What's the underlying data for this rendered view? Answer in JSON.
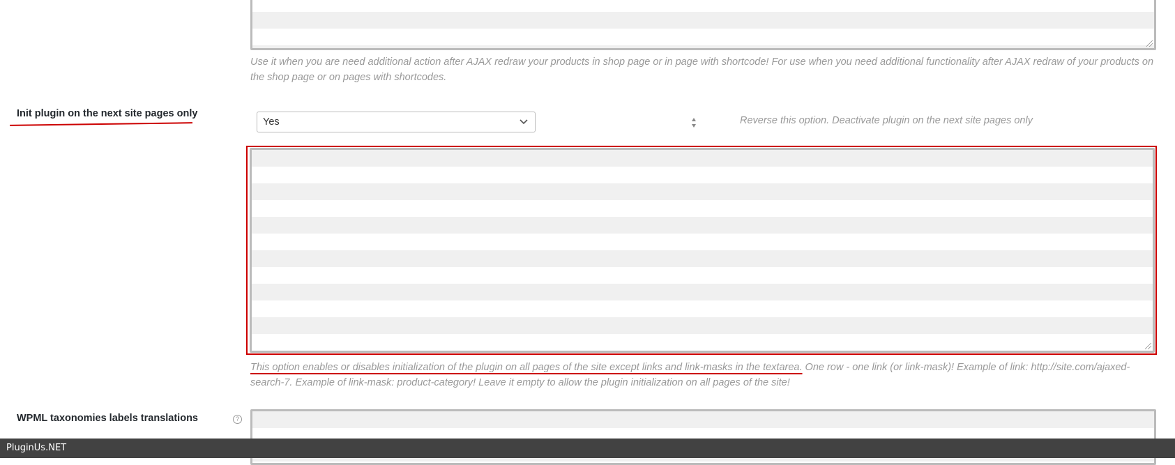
{
  "ajax_redraw": {
    "description": "Use it when you are need additional action after AJAX redraw your products in shop page or in page with shortcode! For use when you need additional functionality after AJAX redraw of your products on the shop page or on pages with shortcodes."
  },
  "init_plugin": {
    "label": "Init plugin on the next site pages only",
    "select_value": "Yes",
    "reverse_text": "Reverse this option. Deactivate plugin on the next site pages only",
    "textarea_value": "",
    "description_underlined": "This option enables or disables initialization of the plugin on all pages of the site except links and link-masks in the textarea.",
    "description_rest": " One row - one link (or link-mask)! Example of link: http://site.com/ajaxed-search-7. Example of link-mask: product-category! Leave it empty to allow the plugin initialization on all pages of the site!"
  },
  "wpml": {
    "label": "WPML taxonomies labels translations",
    "help_icon": "question-circle-icon"
  },
  "footer": {
    "brand": "PluginUs.NET"
  },
  "colors": {
    "highlight": "#cc0000",
    "footer_bg": "#424242"
  }
}
